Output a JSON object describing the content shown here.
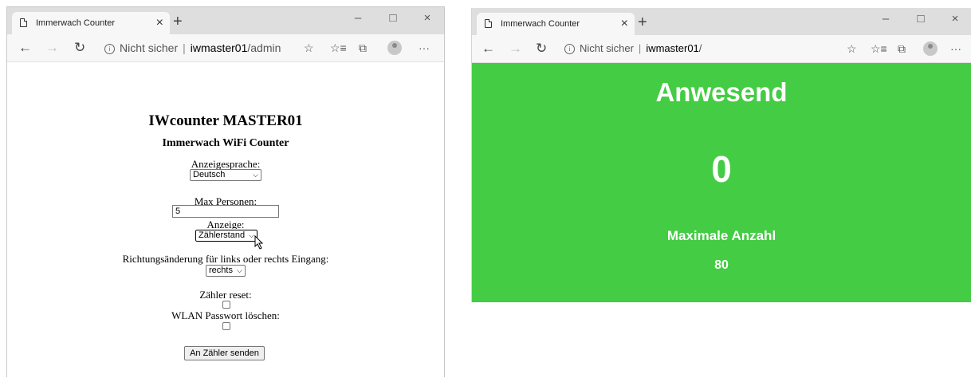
{
  "admin_window": {
    "tab_title": "Immerwach Counter",
    "address_security": "Nicht sicher",
    "address_host": "iwmaster01",
    "address_path": "/admin",
    "page": {
      "title": "IWcounter MASTER01",
      "subtitle": "Immerwach WiFi Counter",
      "language_label": "Anzeigesprache:",
      "language_value": "Deutsch",
      "max_persons_label": "Max Personen:",
      "max_persons_value": "5",
      "display_label": "Anzeige:",
      "display_value": "Zählerstand",
      "direction_label": "Richtungsänderung für links oder rechts Eingang:",
      "direction_value": "rechts",
      "reset_label": "Zähler reset:",
      "wifi_reset_label": "WLAN Passwort löschen:",
      "submit_label": "An Zähler senden"
    }
  },
  "counter_window": {
    "tab_title": "Immerwach Counter",
    "address_security": "Nicht sicher",
    "address_host": "iwmaster01",
    "address_path": "/",
    "page": {
      "heading": "Anwesend",
      "count": "0",
      "max_label": "Maximale Anzahl",
      "max_value": "80",
      "background_color": "#44cc44"
    }
  },
  "icons": {
    "close": "×",
    "new_tab": "+",
    "minimize": "–",
    "maximize": "□",
    "back": "←",
    "forward": "→",
    "refresh": "↻",
    "favorite": "☆",
    "favorites_list": "☆≡",
    "collections": "⧉",
    "more": "···",
    "chevron": "⌄"
  }
}
